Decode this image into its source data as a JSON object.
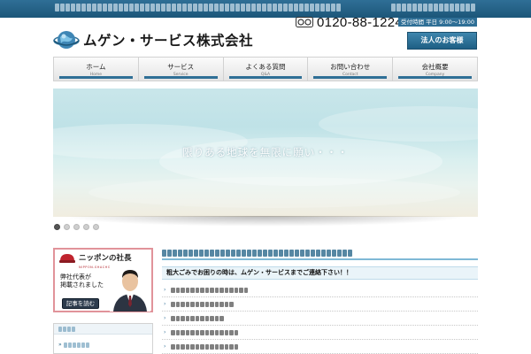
{
  "company": {
    "name": "ムゲン・サービス株式会社"
  },
  "contact": {
    "phone": "0120-88-1224",
    "hours": "受付時間 平日 9:00〜19:00"
  },
  "corporate_button": "法人のお客様",
  "nav": [
    {
      "jp": "ホーム",
      "en": "Home"
    },
    {
      "jp": "サービス",
      "en": "Service"
    },
    {
      "jp": "よくある質問",
      "en": "Q&A"
    },
    {
      "jp": "お問い合わせ",
      "en": "Contact"
    },
    {
      "jp": "会社概要",
      "en": "Company"
    }
  ],
  "hero": {
    "caption": "限りある地球を無限に願い・・・"
  },
  "slider": {
    "slide_count": 5,
    "active_index": 0
  },
  "banner": {
    "title": "ニッポンの社長",
    "subtitle": "NIPPON-SHACHO",
    "line1": "弊社代表が",
    "line2": "掲載されました",
    "button": "記事を読む"
  },
  "main": {
    "intro": "粗大ごみでお困りの時は、ムゲン・サービスまでご連絡下さい！！",
    "list_count": 5
  },
  "colors": {
    "brand": "#2f6f96",
    "accent_pink": "#e1939a"
  }
}
